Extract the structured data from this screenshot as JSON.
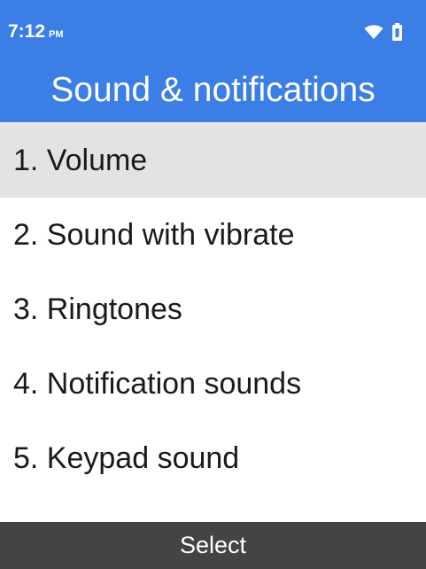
{
  "status_bar": {
    "time": "7:12",
    "ampm": "PM",
    "icons": [
      "wifi-icon",
      "battery-icon"
    ]
  },
  "header": {
    "title": "Sound & notifications",
    "color": "#3b7ee6"
  },
  "menu": {
    "selected_index": 0,
    "selected_color": "#e3e3e3",
    "items": [
      {
        "label": "1. Volume"
      },
      {
        "label": "2. Sound with vibrate"
      },
      {
        "label": "3. Ringtones"
      },
      {
        "label": "4. Notification sounds"
      },
      {
        "label": "5. Keypad sound"
      }
    ]
  },
  "softkeys": {
    "center_label": "Select",
    "color": "#444444"
  }
}
